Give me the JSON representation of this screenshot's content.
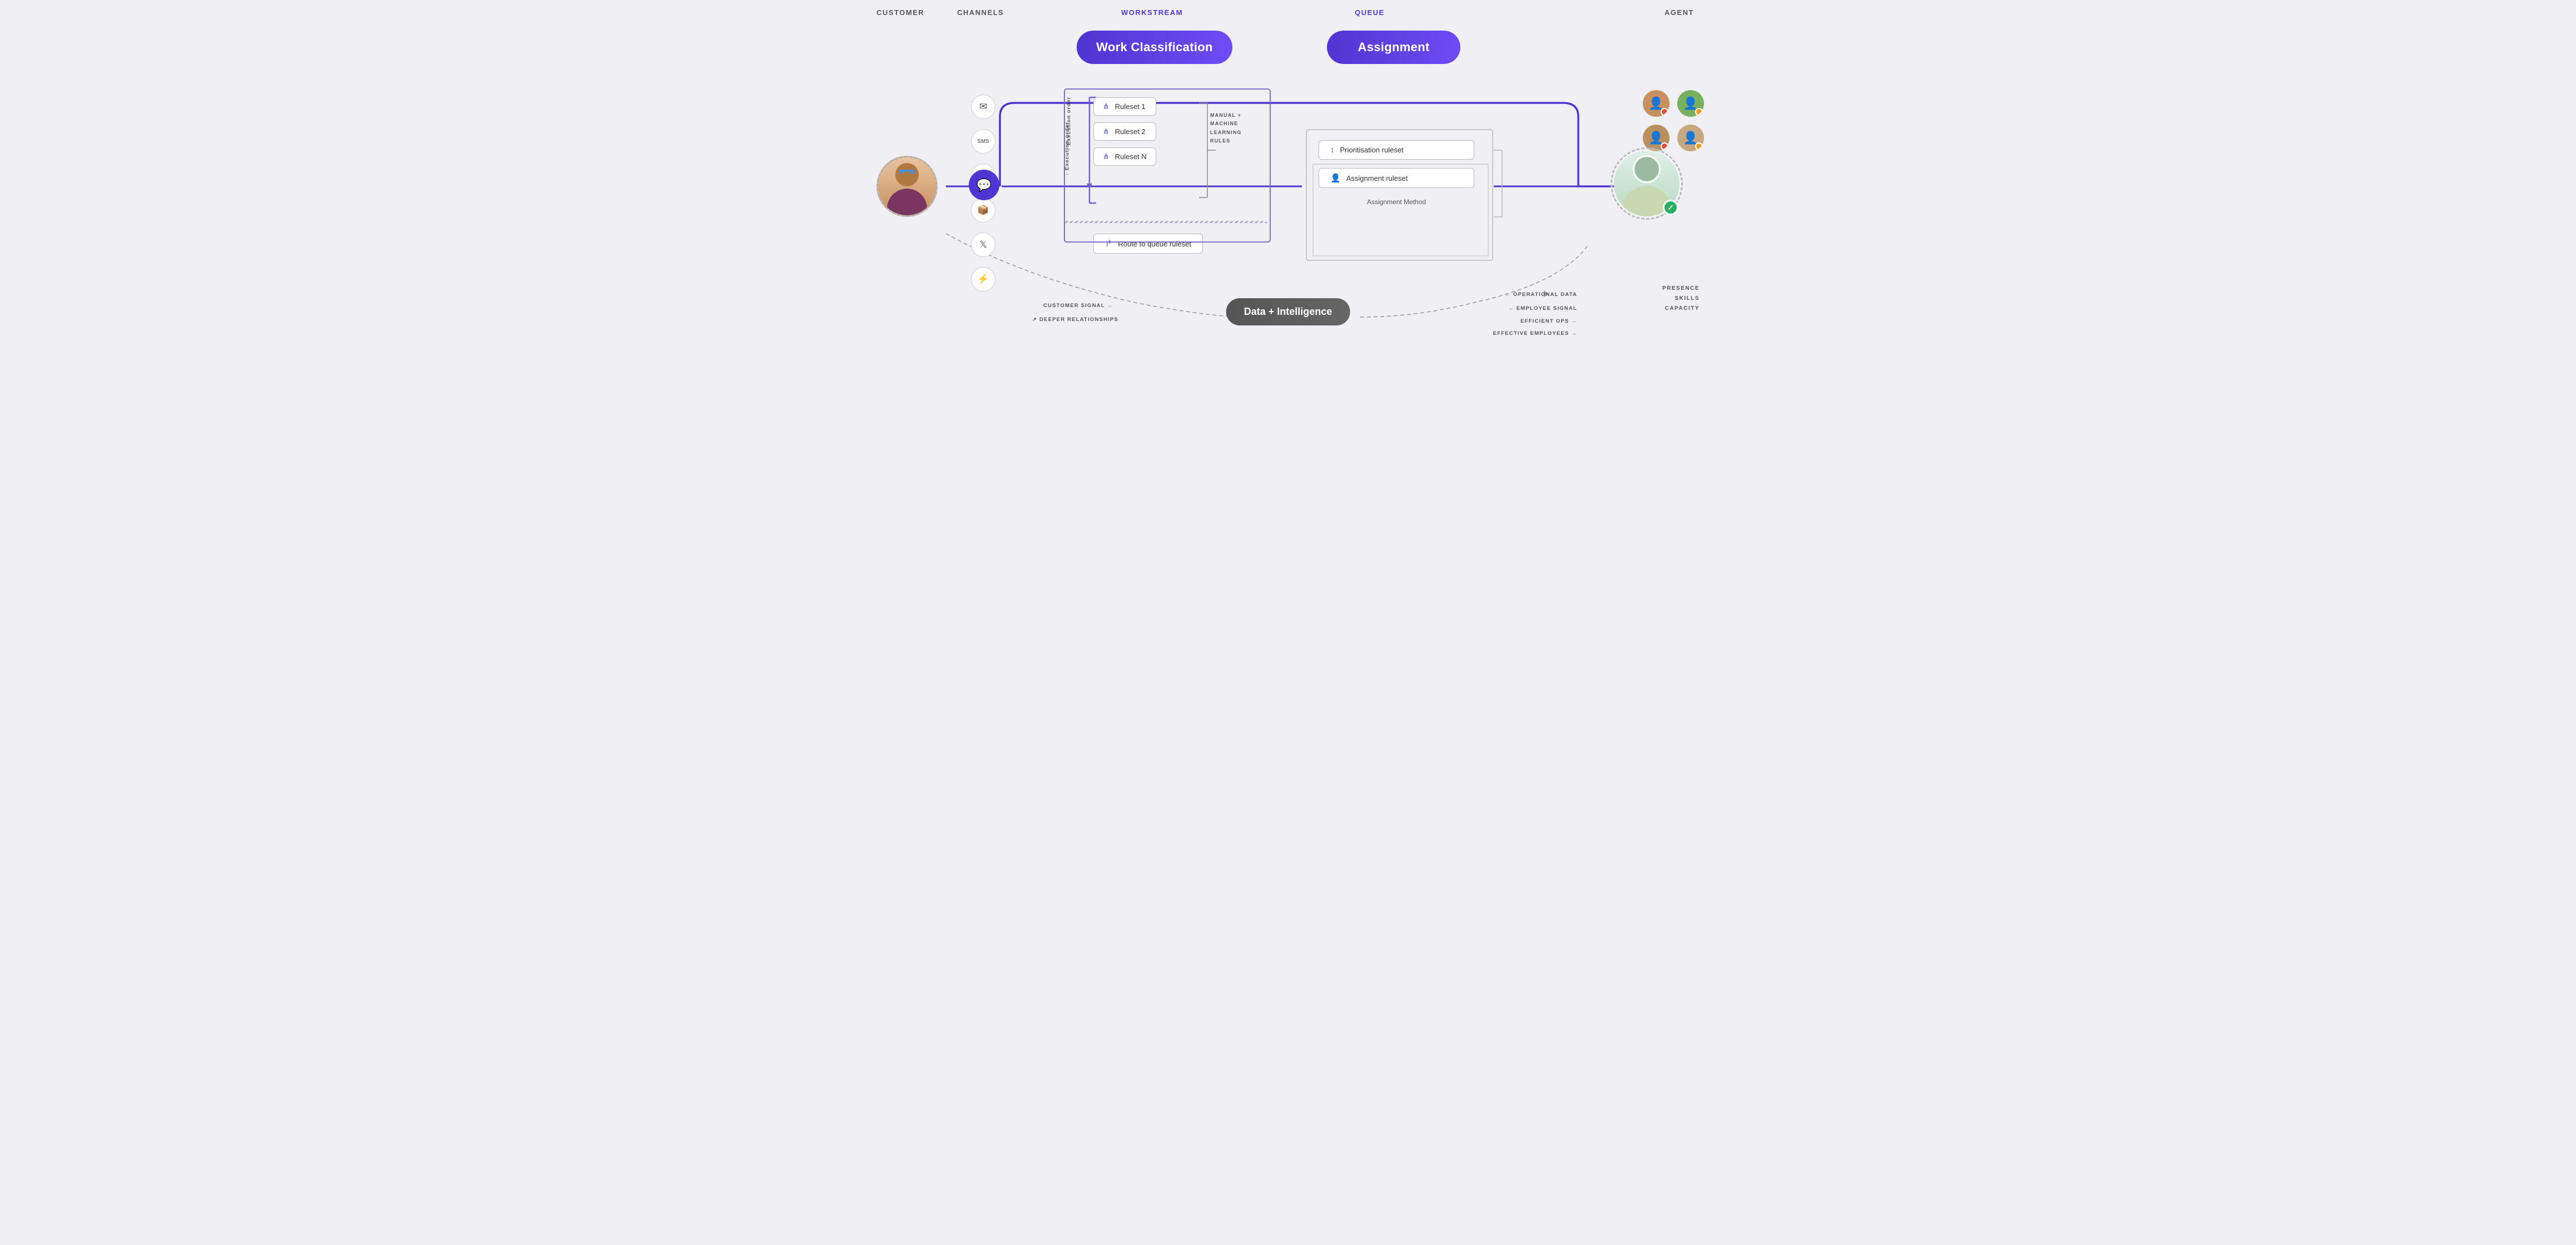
{
  "headers": {
    "customer": "CUSTOMER",
    "channels": "CHANNELS",
    "workstream": "WORKSTREAM",
    "queue": "QUEUE",
    "agent": "AGENT"
  },
  "pills": {
    "work_classification": "Work Classification",
    "assignment": "Assignment",
    "data_intelligence": "Data + Intelligence"
  },
  "rulesets": [
    {
      "label": "Ruleset 1"
    },
    {
      "label": "Ruleset 2"
    },
    {
      "label": "Ruleset N"
    }
  ],
  "ml_label": "MANUAL +\nMACHINE\nLEARNING\nRULES",
  "route_queue": "Route to queue ruleset",
  "queue_items": [
    {
      "label": "Prioritisation ruleset"
    },
    {
      "label": "Assignment ruleset"
    }
  ],
  "assignment_method": "Assignment Method",
  "execution_order": "↓ Execution order",
  "data_flow": {
    "customer_signal": "CUSTOMER SIGNAL →",
    "deeper_relationships": "↗ DEEPER RELATIONSHIPS",
    "operational_data": "← OPERATIONAL DATA",
    "employee_signal": "← EMPLOYEE SIGNAL",
    "efficient_ops": "EFFICIENT OPS →",
    "effective_employees": "EFFECTIVE EMPLOYEES →"
  },
  "agent_labels": {
    "presence": "PRESENCE",
    "skills": "SKILLS",
    "capacity": "CAPACITY"
  },
  "colors": {
    "purple": "#4f35d2",
    "light_purple": "#6e4cf5",
    "dark_bg": "#555555",
    "border": "#bbbbbb",
    "text": "#555555"
  }
}
